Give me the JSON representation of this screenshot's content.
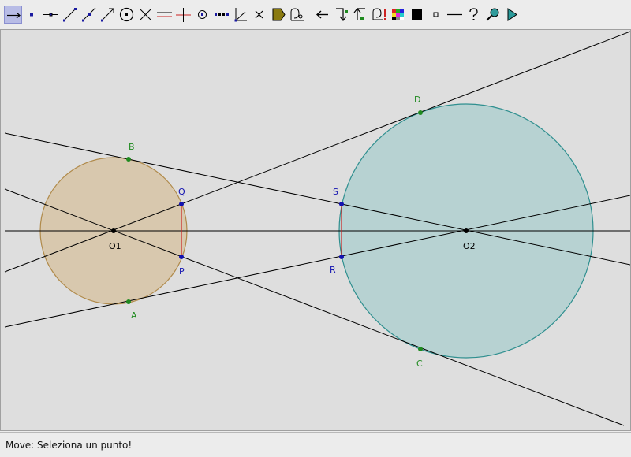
{
  "toolbar": {
    "tools": [
      {
        "icon": "move-arrow-icon"
      },
      {
        "icon": "new-point-icon"
      },
      {
        "icon": "line-through-two-points-icon"
      },
      {
        "icon": "segment-icon"
      },
      {
        "icon": "ray-icon"
      },
      {
        "icon": "vector-icon"
      },
      {
        "icon": "circle-center-point-icon"
      },
      {
        "icon": "intersect-icon"
      },
      {
        "icon": "parallel-line-icon"
      },
      {
        "icon": "perpendicular-line-icon"
      },
      {
        "icon": "midpoint-icon"
      },
      {
        "icon": "dotted-line-icon"
      },
      {
        "icon": "angle-icon"
      },
      {
        "icon": "delete-x-icon"
      },
      {
        "icon": "polygon-icon"
      },
      {
        "icon": "locus-icon"
      },
      {
        "icon": "undo-arrow-icon"
      },
      {
        "icon": "reflect-icon"
      },
      {
        "icon": "rotate-icon"
      },
      {
        "icon": "macro-icon"
      },
      {
        "icon": "color-palette-icon"
      },
      {
        "icon": "fill-square-icon"
      },
      {
        "icon": "point-size-icon"
      },
      {
        "icon": "line-style-icon"
      },
      {
        "icon": "help-question-icon"
      },
      {
        "icon": "zoom-magnifier-icon"
      },
      {
        "icon": "play-animation-icon"
      }
    ]
  },
  "drawing": {
    "colors": {
      "circle1_fill": "#d8c8ae",
      "circle1_stroke": "#b08a4a",
      "circle2_fill": "#b7d2d2",
      "circle2_stroke": "#2f8f8f",
      "line": "#000000",
      "chord": "#cc2222",
      "tangent_point": "#1f8a1f",
      "intersection_point": "#1212b0",
      "center_point": "#000000"
    },
    "points": {
      "O1": "O1",
      "O2": "O2",
      "A": "A",
      "B": "B",
      "C": "C",
      "D": "D",
      "P": "P",
      "Q": "Q",
      "R": "R",
      "S": "S"
    }
  },
  "status": {
    "text": "Move: Seleziona un punto!"
  }
}
